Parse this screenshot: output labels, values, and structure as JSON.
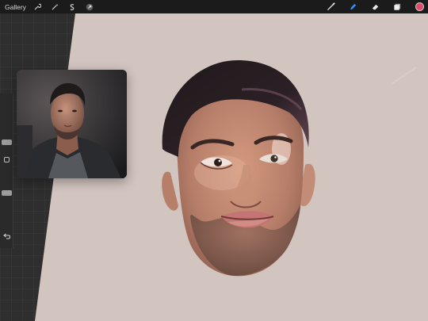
{
  "toolbar": {
    "gallery_label": "Gallery",
    "left_icons": [
      "wrench-icon",
      "magic-wand-icon",
      "selection-icon",
      "transform-arrow-icon"
    ],
    "right_icons": [
      "brush-icon",
      "smudge-icon",
      "eraser-icon",
      "layers-icon",
      "color-icon"
    ],
    "active_tool": "smudge-icon",
    "color": "#e24a6b"
  },
  "sidebar": {
    "controls": [
      "brush-size-slider",
      "modify-button",
      "opacity-slider",
      "undo-button"
    ]
  },
  "reference": {
    "visible": true
  },
  "canvas": {
    "background": "#d2c4bf"
  }
}
